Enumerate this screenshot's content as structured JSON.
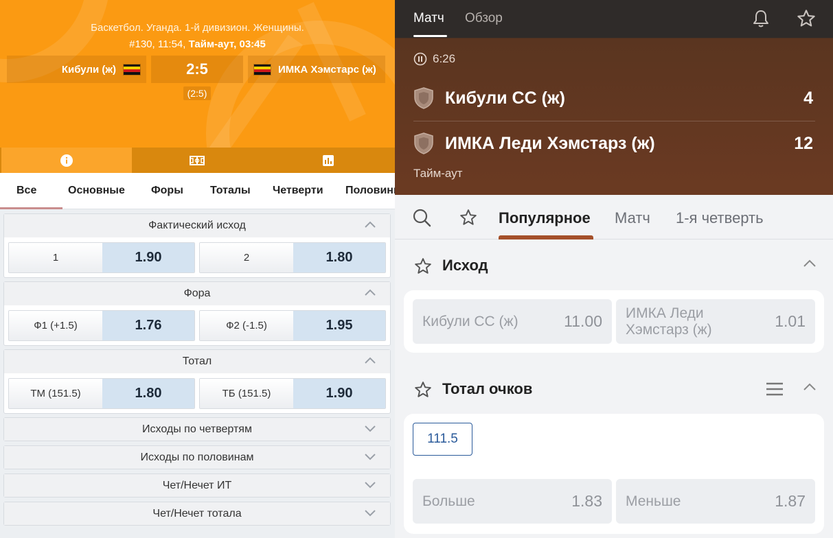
{
  "left": {
    "header": {
      "sport_line": "Баскетбол. Уганда. 1-й дивизион. Женщины.",
      "match_number_time": "#130, 11:54,",
      "status": "Тайм-аут, 03:45",
      "team1": "Кибули (ж)",
      "team2": "ИМКА Хэмстарс (ж)",
      "score": "2:5",
      "period_score": "(2:5)"
    },
    "hero_tabs": [
      "info-icon",
      "field-icon",
      "stats-icon"
    ],
    "category_tabs": [
      "Все",
      "Основные",
      "Форы",
      "Тоталы",
      "Четверти",
      "Половины"
    ],
    "markets": [
      {
        "title": "Фактический исход",
        "outcomes": [
          {
            "label": "1",
            "odd": "1.90"
          },
          {
            "label": "2",
            "odd": "1.80"
          }
        ]
      },
      {
        "title": "Фора",
        "outcomes": [
          {
            "label": "Ф1 (+1.5)",
            "odd": "1.76"
          },
          {
            "label": "Ф2 (-1.5)",
            "odd": "1.95"
          }
        ]
      },
      {
        "title": "Тотал",
        "outcomes": [
          {
            "label": "ТМ (151.5)",
            "odd": "1.80"
          },
          {
            "label": "ТБ (151.5)",
            "odd": "1.90"
          }
        ]
      }
    ],
    "collapsed_markets": [
      "Исходы по четвертям",
      "Исходы по половинам",
      "Чет/Нечет ИТ",
      "Чет/Нечет тотала"
    ],
    "colors": {
      "hero": "#fb9a12",
      "odd_bg": "#d4e3f1"
    }
  },
  "right": {
    "top_tabs": {
      "match": "Матч",
      "overview": "Обзор"
    },
    "timer": "6:26",
    "team1": {
      "name": "Кибули СС (ж)",
      "score": "4"
    },
    "team2": {
      "name": "ИМКА Леди Хэмстарз (ж)",
      "score": "12"
    },
    "status": "Тайм-аут",
    "tabs": {
      "popular": "Популярное",
      "match": "Матч",
      "q1": "1-я четверть"
    },
    "outcome": {
      "title": "Исход",
      "home": {
        "label": "Кибули СС (ж)",
        "odd": "11.00"
      },
      "away": {
        "label_line1": "ИМКА Леди",
        "label_line2": "Хэмстарз (ж)",
        "odd": "1.01"
      }
    },
    "total": {
      "title": "Тотал очков",
      "line": "111.5",
      "over": {
        "label": "Больше",
        "odd": "1.83"
      },
      "under": {
        "label": "Меньше",
        "odd": "1.87"
      }
    },
    "colors": {
      "header": "#6b3a22",
      "accent": "#a4502a",
      "chip": "#2a5a9a"
    }
  }
}
